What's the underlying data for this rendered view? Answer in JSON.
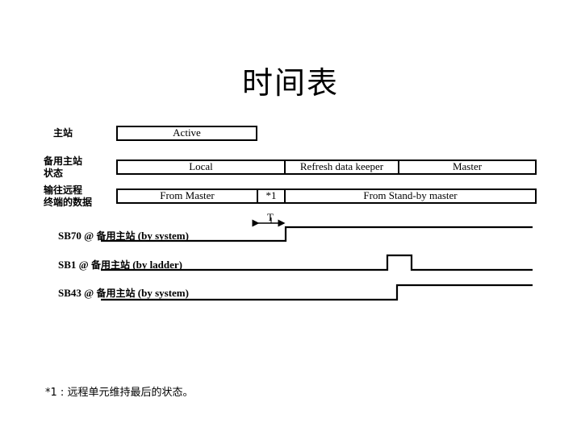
{
  "title": "时间表",
  "rows": {
    "master_station": {
      "label": "主站",
      "segments": [
        {
          "text": "Active"
        }
      ]
    },
    "standby_state": {
      "label_line1": "备用主站",
      "label_line2": "状态",
      "segments": [
        {
          "text": "Local"
        },
        {
          "text": "Refresh data keeper"
        },
        {
          "text": "Master"
        }
      ]
    },
    "remote_output": {
      "label_line1": "输往远程",
      "label_line2": "终端的数据",
      "segments": [
        {
          "text": "From Master"
        },
        {
          "text": "*1"
        },
        {
          "text": "From Stand-by master"
        }
      ]
    }
  },
  "interval_marker": {
    "label": "T"
  },
  "signals": [
    {
      "name": "SB70",
      "at": "@",
      "station": "备用主站",
      "source": "(by system)"
    },
    {
      "name": "SB1",
      "at": "@",
      "station": "备用主站",
      "source": "(by ladder)"
    },
    {
      "name": "SB43",
      "at": "@",
      "station": "备用主站",
      "source": "(by system)"
    }
  ],
  "footnote": {
    "marker": "*1",
    "separator": ":",
    "text": "远程单元维持最后的状态。"
  }
}
